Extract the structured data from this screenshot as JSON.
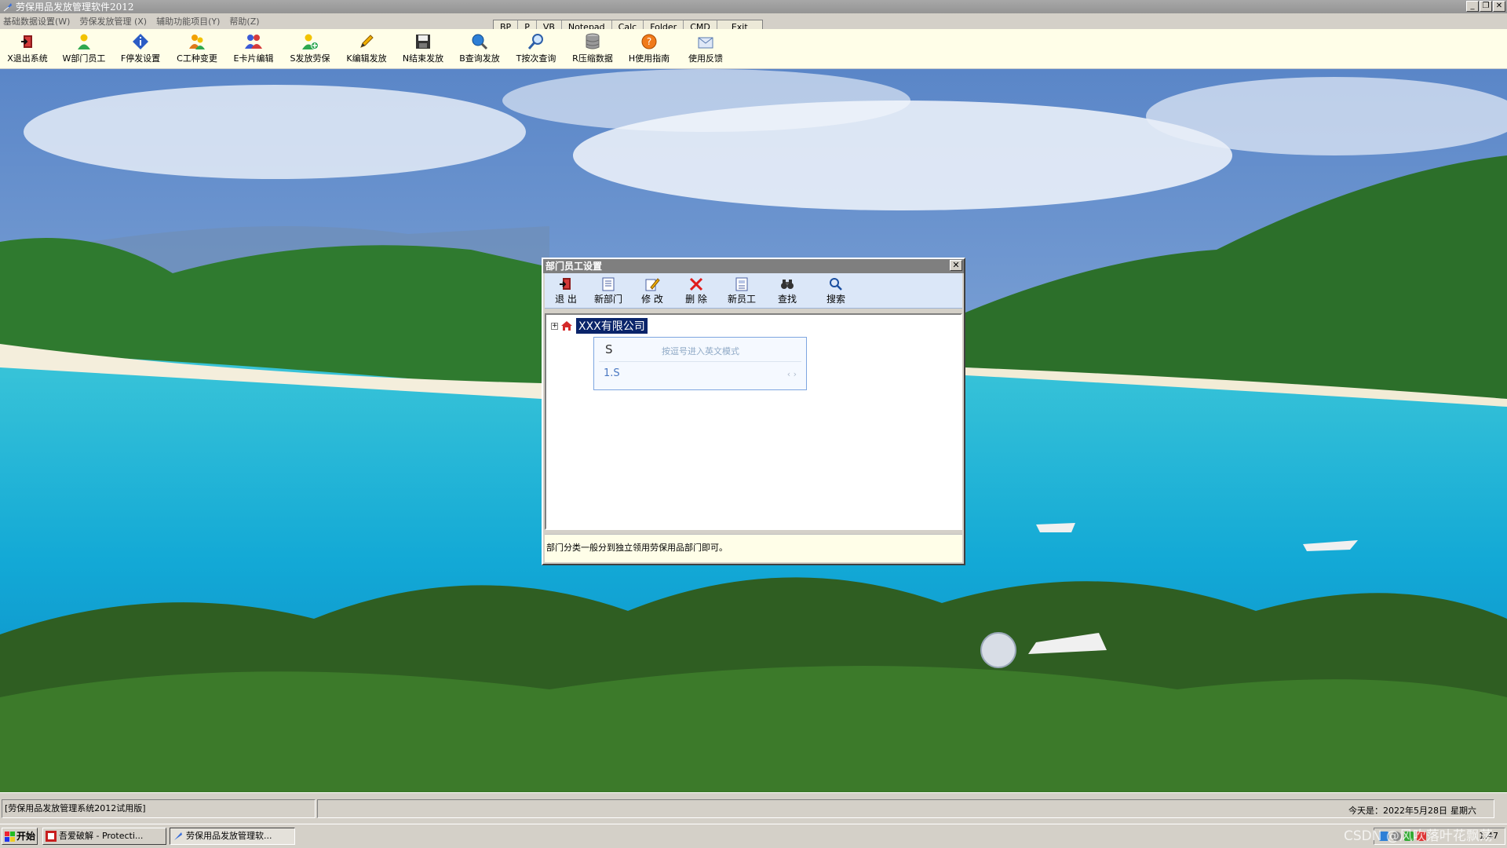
{
  "window": {
    "title": "劳保用品发放管理软件2012",
    "minimize": "_",
    "restore": "❐",
    "close": "✕"
  },
  "menubar": {
    "items": [
      "基础数据设置(W)",
      "劳保发放管理 (X)",
      "辅助功能项目(Y)",
      "帮助(Z)"
    ]
  },
  "quickbar": {
    "items": [
      "BP",
      "P",
      "VB",
      "Notepad",
      "Calc",
      "Folder",
      "CMD",
      "Exit"
    ]
  },
  "toolbar": {
    "buttons": [
      {
        "label": "X退出系统",
        "icon": "exit-door-icon"
      },
      {
        "label": "W部门员工",
        "icon": "person-icon"
      },
      {
        "label": "F停发设置",
        "icon": "diamond-info-icon"
      },
      {
        "label": "C工种变更",
        "icon": "people-change-icon"
      },
      {
        "label": "E卡片编辑",
        "icon": "people-card-icon"
      },
      {
        "label": "S发放劳保",
        "icon": "person-add-icon"
      },
      {
        "label": "K编辑发放",
        "icon": "pencil-icon"
      },
      {
        "label": "N结束发放",
        "icon": "floppy-disk-icon"
      },
      {
        "label": "B查询发放",
        "icon": "globe-search-icon"
      },
      {
        "label": "T按次查询",
        "icon": "magnifier-icon"
      },
      {
        "label": "R压缩数据",
        "icon": "database-icon"
      },
      {
        "label": "H使用指南",
        "icon": "help-icon"
      },
      {
        "label": "使用反馈",
        "icon": "envelope-icon"
      }
    ]
  },
  "dialog": {
    "title": "部门员工设置",
    "close": "✕",
    "buttons": [
      {
        "label": "退 出",
        "icon": "exit-door-icon"
      },
      {
        "label": "新部门",
        "icon": "document-icon"
      },
      {
        "label": "修 改",
        "icon": "edit-icon"
      },
      {
        "label": "删 除",
        "icon": "delete-x-icon"
      },
      {
        "label": "新员工",
        "icon": "form-icon"
      },
      {
        "label": "查找",
        "icon": "binoculars-icon"
      },
      {
        "label": "搜索",
        "icon": "search-icon"
      }
    ],
    "tree": {
      "expander": "+",
      "root_label": "XXX有限公司"
    },
    "ime": {
      "input": "S",
      "hint": "按逗号进入英文模式",
      "candidate": "1.S",
      "arrows": "‹ ›"
    },
    "hint": "部门分类一般分到独立领用劳保用品部门即可。"
  },
  "statusbar": {
    "left": "[劳保用品发放管理系统2012试用版]",
    "date": "今天是：2022年5月28日",
    "weekday": "星期六"
  },
  "taskbar": {
    "start": "开始",
    "tasks": [
      "吾爱破解 - Protecti...",
      "劳保用品发放管理软..."
    ],
    "clock": "1:47"
  },
  "watermark": "CSDN @风吹落叶花飘荡"
}
